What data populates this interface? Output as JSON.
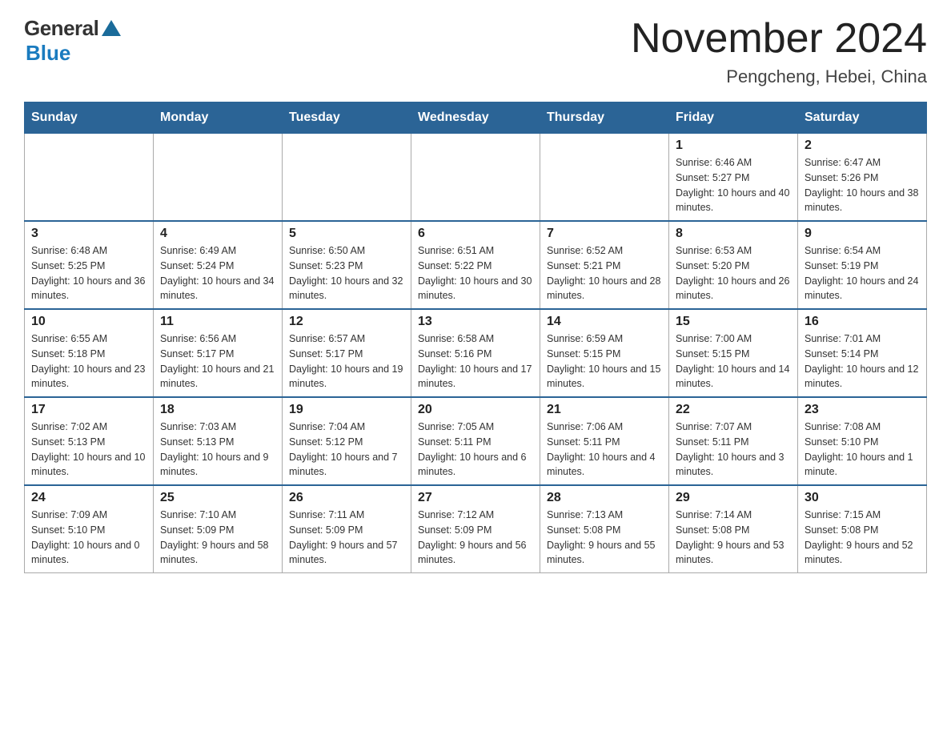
{
  "header": {
    "logo_general": "General",
    "logo_blue": "Blue",
    "title": "November 2024",
    "subtitle": "Pengcheng, Hebei, China"
  },
  "weekdays": [
    "Sunday",
    "Monday",
    "Tuesday",
    "Wednesday",
    "Thursday",
    "Friday",
    "Saturday"
  ],
  "weeks": [
    [
      {
        "day": "",
        "sunrise": "",
        "sunset": "",
        "daylight": ""
      },
      {
        "day": "",
        "sunrise": "",
        "sunset": "",
        "daylight": ""
      },
      {
        "day": "",
        "sunrise": "",
        "sunset": "",
        "daylight": ""
      },
      {
        "day": "",
        "sunrise": "",
        "sunset": "",
        "daylight": ""
      },
      {
        "day": "",
        "sunrise": "",
        "sunset": "",
        "daylight": ""
      },
      {
        "day": "1",
        "sunrise": "Sunrise: 6:46 AM",
        "sunset": "Sunset: 5:27 PM",
        "daylight": "Daylight: 10 hours and 40 minutes."
      },
      {
        "day": "2",
        "sunrise": "Sunrise: 6:47 AM",
        "sunset": "Sunset: 5:26 PM",
        "daylight": "Daylight: 10 hours and 38 minutes."
      }
    ],
    [
      {
        "day": "3",
        "sunrise": "Sunrise: 6:48 AM",
        "sunset": "Sunset: 5:25 PM",
        "daylight": "Daylight: 10 hours and 36 minutes."
      },
      {
        "day": "4",
        "sunrise": "Sunrise: 6:49 AM",
        "sunset": "Sunset: 5:24 PM",
        "daylight": "Daylight: 10 hours and 34 minutes."
      },
      {
        "day": "5",
        "sunrise": "Sunrise: 6:50 AM",
        "sunset": "Sunset: 5:23 PM",
        "daylight": "Daylight: 10 hours and 32 minutes."
      },
      {
        "day": "6",
        "sunrise": "Sunrise: 6:51 AM",
        "sunset": "Sunset: 5:22 PM",
        "daylight": "Daylight: 10 hours and 30 minutes."
      },
      {
        "day": "7",
        "sunrise": "Sunrise: 6:52 AM",
        "sunset": "Sunset: 5:21 PM",
        "daylight": "Daylight: 10 hours and 28 minutes."
      },
      {
        "day": "8",
        "sunrise": "Sunrise: 6:53 AM",
        "sunset": "Sunset: 5:20 PM",
        "daylight": "Daylight: 10 hours and 26 minutes."
      },
      {
        "day": "9",
        "sunrise": "Sunrise: 6:54 AM",
        "sunset": "Sunset: 5:19 PM",
        "daylight": "Daylight: 10 hours and 24 minutes."
      }
    ],
    [
      {
        "day": "10",
        "sunrise": "Sunrise: 6:55 AM",
        "sunset": "Sunset: 5:18 PM",
        "daylight": "Daylight: 10 hours and 23 minutes."
      },
      {
        "day": "11",
        "sunrise": "Sunrise: 6:56 AM",
        "sunset": "Sunset: 5:17 PM",
        "daylight": "Daylight: 10 hours and 21 minutes."
      },
      {
        "day": "12",
        "sunrise": "Sunrise: 6:57 AM",
        "sunset": "Sunset: 5:17 PM",
        "daylight": "Daylight: 10 hours and 19 minutes."
      },
      {
        "day": "13",
        "sunrise": "Sunrise: 6:58 AM",
        "sunset": "Sunset: 5:16 PM",
        "daylight": "Daylight: 10 hours and 17 minutes."
      },
      {
        "day": "14",
        "sunrise": "Sunrise: 6:59 AM",
        "sunset": "Sunset: 5:15 PM",
        "daylight": "Daylight: 10 hours and 15 minutes."
      },
      {
        "day": "15",
        "sunrise": "Sunrise: 7:00 AM",
        "sunset": "Sunset: 5:15 PM",
        "daylight": "Daylight: 10 hours and 14 minutes."
      },
      {
        "day": "16",
        "sunrise": "Sunrise: 7:01 AM",
        "sunset": "Sunset: 5:14 PM",
        "daylight": "Daylight: 10 hours and 12 minutes."
      }
    ],
    [
      {
        "day": "17",
        "sunrise": "Sunrise: 7:02 AM",
        "sunset": "Sunset: 5:13 PM",
        "daylight": "Daylight: 10 hours and 10 minutes."
      },
      {
        "day": "18",
        "sunrise": "Sunrise: 7:03 AM",
        "sunset": "Sunset: 5:13 PM",
        "daylight": "Daylight: 10 hours and 9 minutes."
      },
      {
        "day": "19",
        "sunrise": "Sunrise: 7:04 AM",
        "sunset": "Sunset: 5:12 PM",
        "daylight": "Daylight: 10 hours and 7 minutes."
      },
      {
        "day": "20",
        "sunrise": "Sunrise: 7:05 AM",
        "sunset": "Sunset: 5:11 PM",
        "daylight": "Daylight: 10 hours and 6 minutes."
      },
      {
        "day": "21",
        "sunrise": "Sunrise: 7:06 AM",
        "sunset": "Sunset: 5:11 PM",
        "daylight": "Daylight: 10 hours and 4 minutes."
      },
      {
        "day": "22",
        "sunrise": "Sunrise: 7:07 AM",
        "sunset": "Sunset: 5:11 PM",
        "daylight": "Daylight: 10 hours and 3 minutes."
      },
      {
        "day": "23",
        "sunrise": "Sunrise: 7:08 AM",
        "sunset": "Sunset: 5:10 PM",
        "daylight": "Daylight: 10 hours and 1 minute."
      }
    ],
    [
      {
        "day": "24",
        "sunrise": "Sunrise: 7:09 AM",
        "sunset": "Sunset: 5:10 PM",
        "daylight": "Daylight: 10 hours and 0 minutes."
      },
      {
        "day": "25",
        "sunrise": "Sunrise: 7:10 AM",
        "sunset": "Sunset: 5:09 PM",
        "daylight": "Daylight: 9 hours and 58 minutes."
      },
      {
        "day": "26",
        "sunrise": "Sunrise: 7:11 AM",
        "sunset": "Sunset: 5:09 PM",
        "daylight": "Daylight: 9 hours and 57 minutes."
      },
      {
        "day": "27",
        "sunrise": "Sunrise: 7:12 AM",
        "sunset": "Sunset: 5:09 PM",
        "daylight": "Daylight: 9 hours and 56 minutes."
      },
      {
        "day": "28",
        "sunrise": "Sunrise: 7:13 AM",
        "sunset": "Sunset: 5:08 PM",
        "daylight": "Daylight: 9 hours and 55 minutes."
      },
      {
        "day": "29",
        "sunrise": "Sunrise: 7:14 AM",
        "sunset": "Sunset: 5:08 PM",
        "daylight": "Daylight: 9 hours and 53 minutes."
      },
      {
        "day": "30",
        "sunrise": "Sunrise: 7:15 AM",
        "sunset": "Sunset: 5:08 PM",
        "daylight": "Daylight: 9 hours and 52 minutes."
      }
    ]
  ]
}
